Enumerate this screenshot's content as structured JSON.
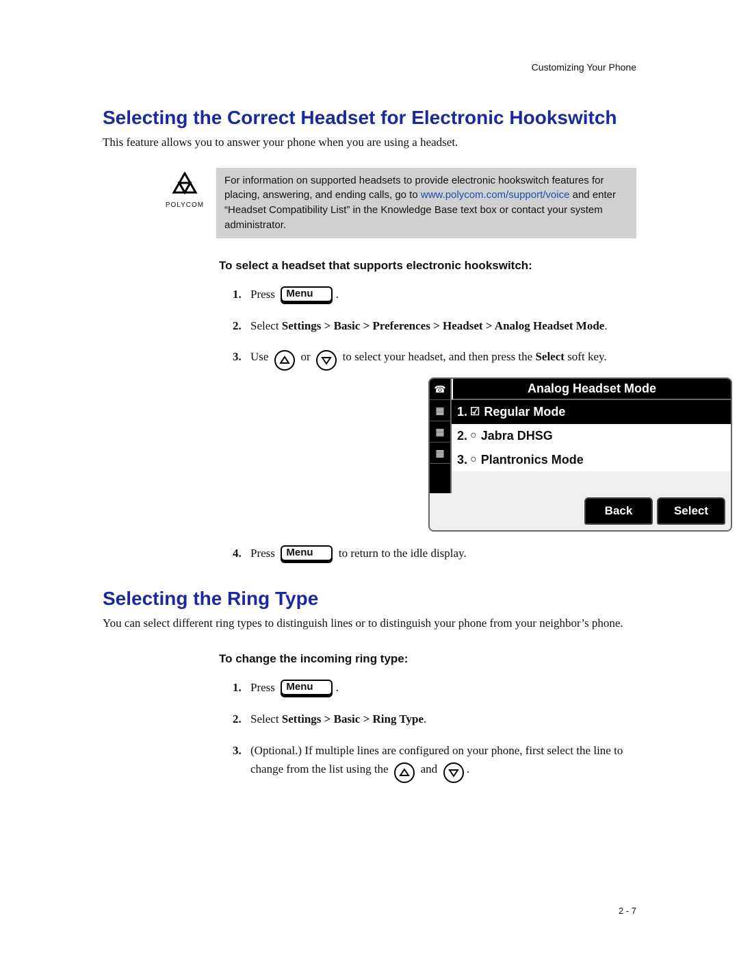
{
  "running_head": "Customizing Your Phone",
  "page_number": "2 - 7",
  "section1": {
    "title": "Selecting the Correct Headset for Electronic Hookswitch",
    "intro": "This feature allows you to answer your phone when you are using a headset.",
    "note_before": "For information on supported headsets to provide electronic hookswitch features for placing, answering, and ending calls, go to ",
    "note_link_text": "www.polycom.com/support/voice",
    "note_after": " and enter “Headset Compatibility List” in the Knowledge Base text box or contact your system administrator.",
    "logo_caption": "POLYCOM",
    "sub": "To select a headset that supports electronic hookswitch:",
    "menu_label": "Menu",
    "step1_press": "Press",
    "step2_prefix": "Select ",
    "step2_path": "Settings > Basic > Preferences > Headset > Analog Headset Mode",
    "step3_a": "Use",
    "step3_b": "or",
    "step3_c": "to select your headset, and then press the ",
    "step3_select": "Select",
    "step3_d": " soft key.",
    "step4_a": "Press",
    "step4_b": "to return to the idle display."
  },
  "phone": {
    "title": "Analog Headset Mode",
    "rows": [
      {
        "n": "1.",
        "mark": "☑",
        "label": "Regular Mode",
        "selected": true
      },
      {
        "n": "2.",
        "mark": "○",
        "label": "Jabra DHSG",
        "selected": false
      },
      {
        "n": "3.",
        "mark": "○",
        "label": "Plantronics Mode",
        "selected": false
      }
    ],
    "soft_back": "Back",
    "soft_select": "Select"
  },
  "section2": {
    "title": "Selecting the Ring Type",
    "intro": "You can select different ring types to distinguish lines or to distinguish your phone from your neighbor’s phone.",
    "sub": "To change the incoming ring type:",
    "menu_label": "Menu",
    "step1_press": "Press",
    "step2_prefix": "Select ",
    "step2_path": "Settings > Basic > Ring Type",
    "step3_a": "(Optional.) If multiple lines are configured on your phone, first select the line to change from the list using the",
    "step3_and": "and"
  }
}
